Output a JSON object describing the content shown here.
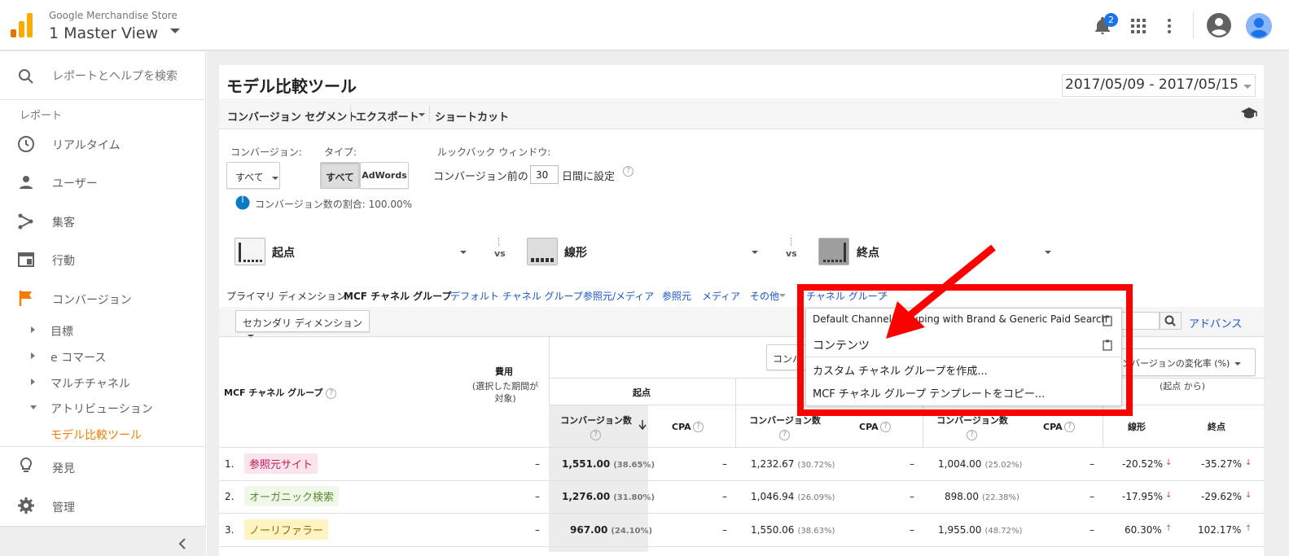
{
  "header": {
    "account": "Google Merchandise Store",
    "view": "1 Master View",
    "notification_count": "2"
  },
  "sidebar": {
    "search_placeholder": "レポートとヘルプを検索",
    "section_label": "レポート",
    "items": [
      {
        "label": "リアルタイム",
        "icon": "clock-icon"
      },
      {
        "label": "ユーザー",
        "icon": "person-icon"
      },
      {
        "label": "集客",
        "icon": "acquisition-icon"
      },
      {
        "label": "行動",
        "icon": "behavior-icon"
      },
      {
        "label": "コンバージョン",
        "icon": "flag-icon"
      }
    ],
    "sub_items": [
      "目標",
      "e コマース",
      "マルチチャネル",
      "アトリビューション"
    ],
    "active_item": "モデル比較ツール",
    "discover": "発見",
    "admin": "管理"
  },
  "page": {
    "title": "モデル比較ツール",
    "date_range": "2017/05/09 - 2017/05/15"
  },
  "toolbar": {
    "segment": "コンバージョン セグメント",
    "export": "エクスポート",
    "shortcut": "ショートカット"
  },
  "controls": {
    "conversion_label": "コンバージョン:",
    "conversion_value": "すべて",
    "type_label": "タイプ:",
    "type_all": "すべて",
    "type_adwords": "AdWords",
    "lookback_label": "ルックバック ウィンドウ:",
    "lookback_prefix": "コンバージョン前の",
    "lookback_value": "30",
    "lookback_suffix": "日間に設定",
    "share_text": "コンバージョン数の割合: 100.00%"
  },
  "models": [
    {
      "label": "起点"
    },
    {
      "label": "線形"
    },
    {
      "label": "終点"
    }
  ],
  "vs": "vs",
  "dimensions": {
    "label": "プライマリ ディメンション:",
    "active": "MCF チャネル グループ",
    "links": [
      "デフォルト チャネル グループ",
      "参照元/メディア",
      "参照元",
      "メディア",
      "その他"
    ],
    "open": "チャネル グループ"
  },
  "secondary_dimension": "セカンダリ ディメンション",
  "advanced": "アドバンス",
  "dropdown": {
    "items": [
      "Default Channel Grouping with Brand & Generic Paid Search",
      "コンテンツ",
      "カスタム チャネル グループを作成...",
      "MCF チャネル グループ テンプレートをコピー..."
    ]
  },
  "table": {
    "dim_header": "MCF チャネル グループ",
    "cost_header": "費用",
    "cost_sub": "(選択した期間が対象)",
    "metric_select": "コンバ",
    "change_select": "ンバージョンの変化率 (%)",
    "change_sub": "(起点 から)",
    "model_headers": [
      "起点"
    ],
    "col_conv": "コンバージョン数",
    "col_cpa": "CPA",
    "col_linear": "線形",
    "col_last": "終点",
    "rows": [
      {
        "num": "1.",
        "name": "参照元サイト",
        "cost": "–",
        "first": "1,551.00",
        "first_pct": "(38.65%)",
        "cpa1": "–",
        "lin": "1,232.67",
        "lin_pct": "(30.72%)",
        "cpa2": "–",
        "last": "1,004.00",
        "last_pct": "(25.02%)",
        "cpa3": "–",
        "chg_lin": "-20.52%",
        "chg_last": "-35.27%"
      },
      {
        "num": "2.",
        "name": "オーガニック検索",
        "cost": "–",
        "first": "1,276.00",
        "first_pct": "(31.80%)",
        "cpa1": "–",
        "lin": "1,046.94",
        "lin_pct": "(26.09%)",
        "cpa2": "–",
        "last": "898.00",
        "last_pct": "(22.38%)",
        "cpa3": "–",
        "chg_lin": "-17.95%",
        "chg_last": "-29.62%"
      },
      {
        "num": "3.",
        "name": "ノーリファラー",
        "cost": "–",
        "first": "967.00",
        "first_pct": "(24.10%)",
        "cpa1": "–",
        "lin": "1,550.06",
        "lin_pct": "(38.63%)",
        "cpa2": "–",
        "last": "1,955.00",
        "last_pct": "(48.72%)",
        "cpa3": "–",
        "chg_lin": "60.30%",
        "chg_last": "102.17%"
      }
    ]
  },
  "colors": {
    "accent_orange": "#f57c00",
    "link_blue": "#1a55c7",
    "annotation_red": "#ff0000",
    "tag_pink": "#fce4ec",
    "tag_green": "#f1f8e9",
    "tag_yellow": "#fff3c4"
  }
}
